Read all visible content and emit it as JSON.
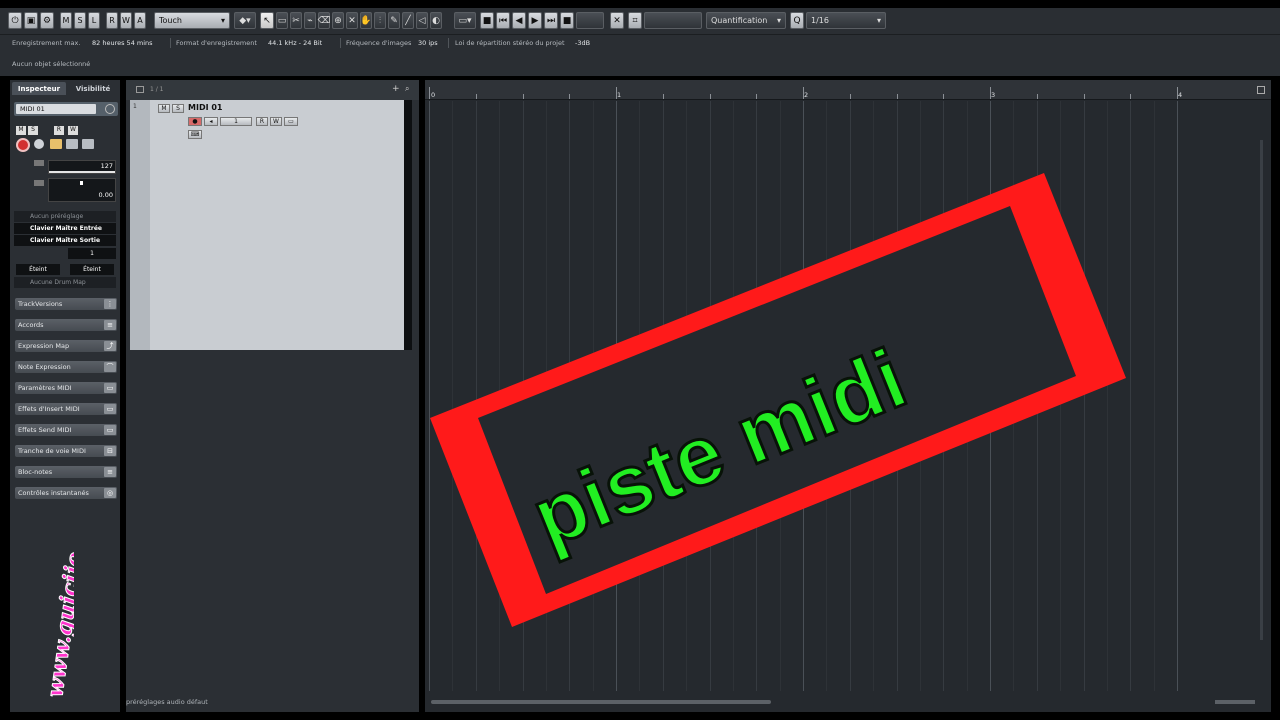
{
  "toolbar": {
    "transport_letters": [
      "M",
      "S",
      "L",
      "R",
      "W",
      "A"
    ],
    "automation_mode": "Touch",
    "quantize_label": "Quantification",
    "quantize_value": "1/16"
  },
  "info_line": {
    "rec_max_label": "Enregistrement max.",
    "rec_max_value": "82 heures 54 mins",
    "format_label": "Format d'enregistrement",
    "format_value": "44.1 kHz - 24 Bit",
    "fps_label": "Fréquence d'images",
    "fps_value": "30 ips",
    "pan_law_label": "Loi de répartition stéréo du projet",
    "pan_law_value": "-3dB"
  },
  "selection_status": "Aucun objet sélectionné",
  "inspector": {
    "tabs": [
      "Inspecteur",
      "Visibilité"
    ],
    "track_name": "MIDI 01",
    "volume_value": "127",
    "pan_value": "0.00",
    "preset_placeholder": "Aucun préréglage",
    "input": "Clavier Maître Entrée",
    "output": "Clavier Maître Sortie",
    "channel": "1",
    "bank_off": "Éteint",
    "program_off": "Éteint",
    "drum_map": "Aucune Drum Map",
    "sections": [
      "TrackVersions",
      "Accords",
      "Expression Map",
      "Note Expression",
      "Paramètres MIDI",
      "Effets d'Insert MIDI",
      "Effets Send MIDI",
      "Tranche de voie MIDI",
      "Bloc-notes",
      "Contrôles instantanés"
    ]
  },
  "track_list": {
    "page_counter": "1 / 1",
    "track_number": "1",
    "track_name": "MIDI 01",
    "mute": "M",
    "solo": "S",
    "read": "R",
    "write": "W",
    "channel": "1",
    "status_preset": "préréglages audio défaut"
  },
  "ruler": {
    "labels": [
      "0",
      "1",
      "2",
      "3",
      "4"
    ]
  },
  "overlay": {
    "stamp_text": "piste midi",
    "watermark_text": "www.guicijo"
  },
  "colors": {
    "stamp_red": "#ff1a1a",
    "stamp_green": "#22ee22",
    "watermark_pink": "#ff33cc",
    "record_red": "#d23030"
  }
}
